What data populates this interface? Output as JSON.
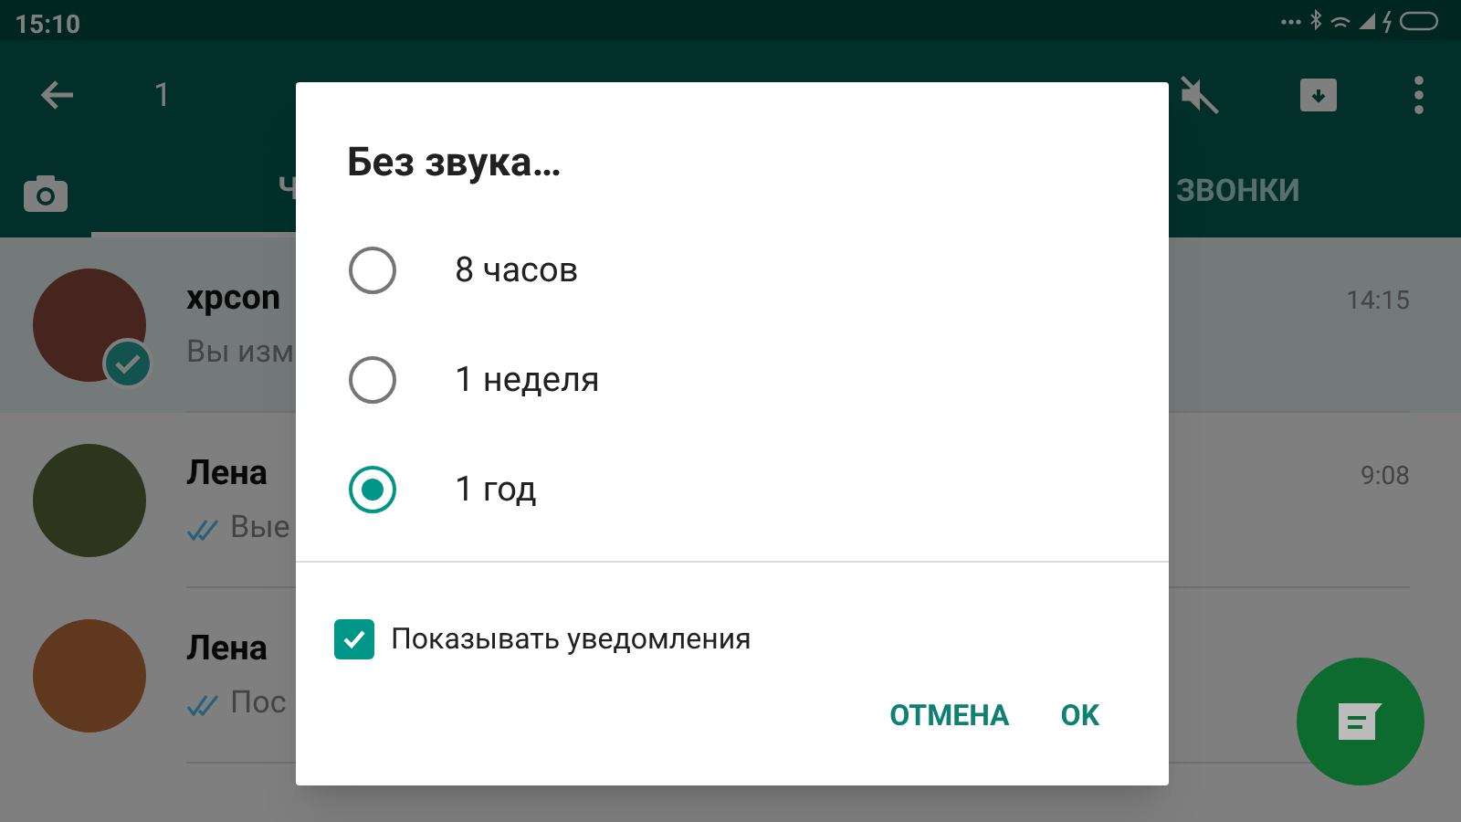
{
  "status_bar": {
    "time": "15:10"
  },
  "toolbar": {
    "count": "1"
  },
  "tabs": [
    {
      "label": "Ч",
      "selected": true
    },
    {
      "label": "ЗВОНКИ",
      "selected": false
    }
  ],
  "chats": [
    {
      "name": "xpcon",
      "preview": "Вы изм",
      "time": "14:15",
      "selected": true,
      "ticks": false
    },
    {
      "name": "Лена",
      "preview": "Вые",
      "time": "9:08",
      "selected": false,
      "ticks": true
    },
    {
      "name": "Лена",
      "preview": "Пос",
      "selected": false,
      "ticks": true
    }
  ],
  "dialog": {
    "title": "Без звука…",
    "options": [
      {
        "label": "8 часов",
        "selected": false
      },
      {
        "label": "1 неделя",
        "selected": false
      },
      {
        "label": "1 год",
        "selected": true
      }
    ],
    "checkbox": {
      "label": "Показывать уведомления",
      "checked": true
    },
    "buttons": [
      "ОТМЕНА",
      "OK"
    ]
  }
}
